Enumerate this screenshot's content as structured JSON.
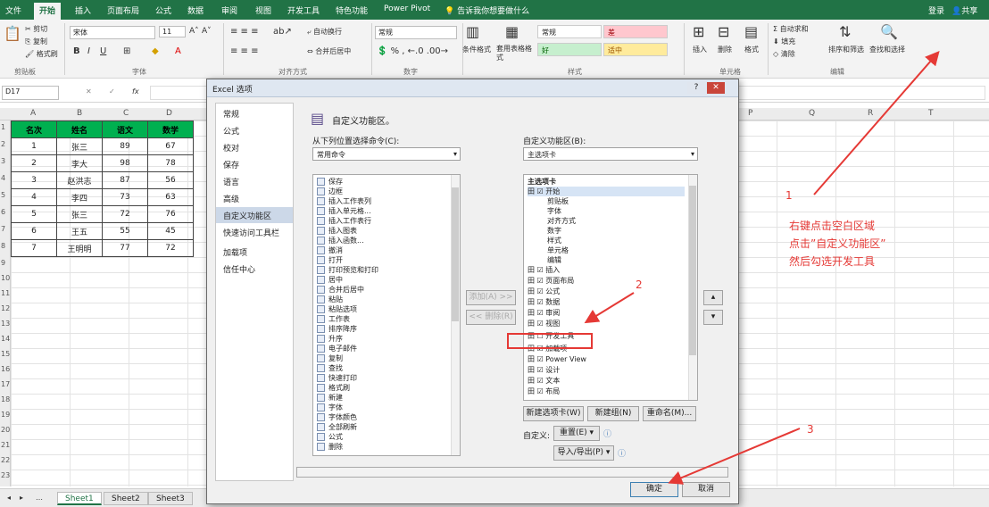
{
  "ribbon_tabs": [
    "文件",
    "开始",
    "插入",
    "页面布局",
    "公式",
    "数据",
    "审阅",
    "视图",
    "开发工具",
    "特色功能",
    "Power Pivot",
    "告诉我你想要做什么"
  ],
  "account": {
    "login": "登录",
    "share": "共享"
  },
  "clipboard": {
    "cut": "剪切",
    "copy": "复制",
    "paste_format": "格式刷",
    "label": "剪贴板"
  },
  "font": {
    "name": "宋体",
    "size": "11",
    "label": "字体"
  },
  "alignment": {
    "wrap": "自动换行",
    "merge": "合并后居中",
    "label": "对齐方式"
  },
  "number": {
    "format": "常规",
    "label": "数字"
  },
  "styles": {
    "conditional": "条件格式",
    "table_format": "套用表格格式",
    "normal": "常规",
    "bad": "差",
    "good": "好",
    "neutral": "适中",
    "label": "样式"
  },
  "cells": {
    "insert": "插入",
    "delete": "删除",
    "format": "格式",
    "label": "单元格"
  },
  "editing": {
    "autosum": "自动求和",
    "fill": "填充",
    "clear": "清除",
    "sort": "排序和筛选",
    "find": "查找和选择",
    "label": "编辑"
  },
  "formula_bar": {
    "name_box": "D17",
    "fx": "fx"
  },
  "columns": [
    "A",
    "B",
    "C",
    "D",
    "E",
    "F",
    "G",
    "H",
    "I",
    "J",
    "K",
    "L",
    "M",
    "N",
    "O",
    "P",
    "Q",
    "R",
    "S",
    "T",
    "U"
  ],
  "row_numbers": [
    "1",
    "2",
    "3",
    "4",
    "5",
    "6",
    "7",
    "8",
    "9",
    "10",
    "11",
    "12",
    "13",
    "14",
    "15",
    "16",
    "17",
    "18",
    "19",
    "20",
    "21",
    "22",
    "23",
    "24"
  ],
  "table": {
    "headers": [
      "名次",
      "姓名",
      "语文",
      "数学"
    ],
    "rows": [
      [
        "1",
        "张三",
        "89",
        "67"
      ],
      [
        "2",
        "李大",
        "98",
        "78"
      ],
      [
        "3",
        "赵洪志",
        "87",
        "56"
      ],
      [
        "4",
        "李四",
        "73",
        "63"
      ],
      [
        "5",
        "张三",
        "72",
        "76"
      ],
      [
        "6",
        "王五",
        "55",
        "45"
      ],
      [
        "7",
        "王明明",
        "77",
        "72"
      ]
    ]
  },
  "sheet_tabs": [
    "Sheet1",
    "Sheet2",
    "Sheet3"
  ],
  "dialog": {
    "title": "Excel 选项",
    "nav": [
      "常规",
      "公式",
      "校对",
      "保存",
      "语言",
      "高级",
      "自定义功能区",
      "快速访问工具栏",
      "加载项",
      "信任中心"
    ],
    "heading": "自定义功能区。",
    "choose_label": "从下列位置选择命令(C):",
    "choose_value": "常用命令",
    "customize_label": "自定义功能区(B):",
    "customize_value": "主选项卡",
    "commands": [
      "保存",
      "边框",
      "插入工作表列",
      "插入单元格...",
      "插入工作表行",
      "插入图表",
      "插入函数...",
      "撤消",
      "打开",
      "打印预览和打印",
      "居中",
      "合并后居中",
      "粘贴",
      "粘贴选项",
      "工作表",
      "排序降序",
      "升序",
      "电子邮件",
      "复制",
      "查找",
      "快速打印",
      "格式刷",
      "新建",
      "字体",
      "字体颜色",
      "全部刷新",
      "公式",
      "删除"
    ],
    "tree_header": "主选项卡",
    "tree": [
      "田 ☑ 开始",
      "剪贴板",
      "字体",
      "对齐方式",
      "数字",
      "样式",
      "单元格",
      "编辑",
      "田 ☑ 插入",
      "田 ☑ 页面布局",
      "田 ☑ 公式",
      "田 ☑ 数据",
      "田 ☑ 审阅",
      "田 ☑ 视图",
      "田 ☐ 开发工具",
      "田 ☑ 加载项",
      "田 ☑ Power View",
      "田 ☑ 设计",
      "田 ☑ 文本",
      "田 ☑ 布局"
    ],
    "add_button": "添加(A) >>",
    "remove_button": "<< 删除(R)",
    "new_tab": "新建选项卡(W)",
    "new_group": "新建组(N)",
    "rename": "重命名(M)...",
    "customize_label2": "自定义:",
    "reset": "重置(E) ▾",
    "import_export": "导入/导出(P) ▾",
    "ok": "确定",
    "cancel": "取消"
  },
  "annotations": {
    "num1": "1",
    "num2": "2",
    "num3": "3",
    "note_lines": [
      "右键点击空白区域",
      "点击”自定义功能区”",
      "然后勾选开发工具"
    ]
  }
}
